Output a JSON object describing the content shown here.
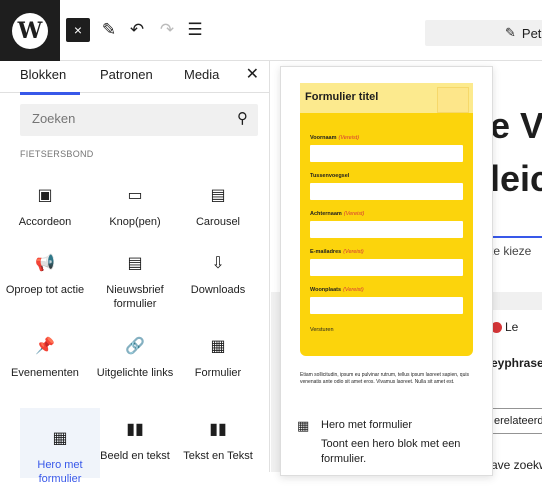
{
  "toolbar": {
    "logo_letter": "W",
    "close_icon": "×",
    "pen_icon": "✎",
    "undo_icon": "↶",
    "redo_icon": "↷",
    "list_icon": "☰",
    "document_title": "Petitie"
  },
  "inserter": {
    "tabs": [
      "Blokken",
      "Patronen",
      "Media"
    ],
    "close_icon": "✕",
    "search": {
      "placeholder": "Zoeken"
    },
    "category": "FIETSERSBOND",
    "blocks": [
      {
        "icon": "▣",
        "label": "Accordeon"
      },
      {
        "icon": "▭",
        "label": "Knop(pen)"
      },
      {
        "icon": "▤",
        "label": "Carousel"
      },
      {
        "icon": "📢",
        "label": "Oproep tot actie"
      },
      {
        "icon": "▤",
        "label": "Nieuwsbrief formulier"
      },
      {
        "icon": "⇩",
        "label": "Downloads"
      },
      {
        "icon": "📌",
        "label": "Evenementen"
      },
      {
        "icon": "🔗",
        "label": "Uitgelichte links"
      },
      {
        "icon": "▦",
        "label": "Formulier"
      },
      {
        "icon": "▦",
        "label": "Hero met formulier"
      },
      {
        "icon": "▮▮",
        "label": "Beeld en tekst"
      },
      {
        "icon": "▮▮",
        "label": "Tekst en Tekst"
      }
    ]
  },
  "preview": {
    "form_title": "Formulier titel",
    "fields": [
      {
        "label": "Voornaam",
        "required": "(Vereist)"
      },
      {
        "label": "Tussenvoegsel",
        "required": ""
      },
      {
        "label": "Achternaam",
        "required": "(Vereist)"
      },
      {
        "label": "E-mailadres",
        "required": "(Vereist)"
      },
      {
        "label": "Woonplaats",
        "required": "(Vereist)"
      }
    ],
    "submit": "Versturen",
    "body_text": "Etiam sollicitudin, ipsum eu pulvinar rutrum, tellus ipsum laoreet sapien, quis venenatis ante odio sit amet eros. Vivamus laoreet. Nulla sit amet est.",
    "block_icon": "▦",
    "block_title": "Hero met formulier",
    "block_description": "Toont een hero blok met een formulier."
  },
  "canvas": {
    "title_line1": "e V",
    "title_line2": "leic",
    "subtitle": "te kieze",
    "panel_tab": "Le",
    "row1": "eyphrase",
    "row2": "erelateerde",
    "row3": "ave zoekw"
  }
}
